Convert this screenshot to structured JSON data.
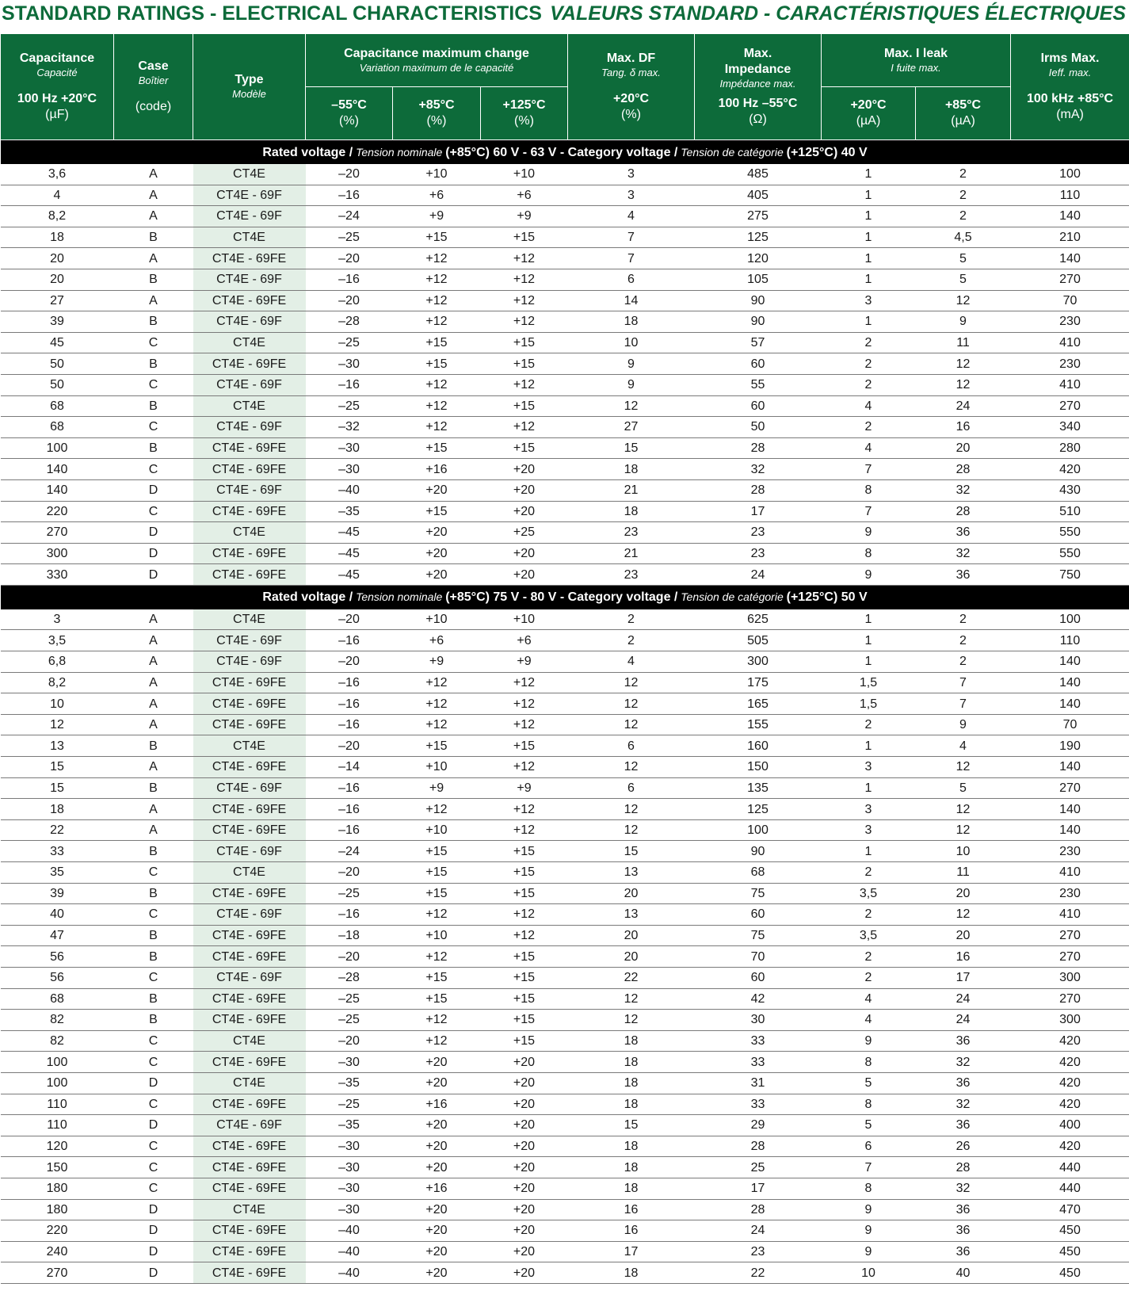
{
  "title_left": "STANDARD RATINGS - ELECTRICAL CHARACTERISTICS",
  "title_right": "VALEURS STANDARD - CARACTÉRISTIQUES ÉLECTRIQUES",
  "headers": {
    "capacitance": {
      "en": "Capacitance",
      "fr": "Capacité",
      "cond": "100 Hz +20°C",
      "unit": "(µF)"
    },
    "case": {
      "en": "Case",
      "fr": "Boîtier",
      "unit": "(code)"
    },
    "type": {
      "en": "Type",
      "fr": "Modèle"
    },
    "cap_change": {
      "en": "Capacitance maximum change",
      "fr": "Variation maximum de le capacité"
    },
    "cap_change_sub": [
      {
        "temp": "–55°C",
        "unit": "(%)"
      },
      {
        "temp": "+85°C",
        "unit": "(%)"
      },
      {
        "temp": "+125°C",
        "unit": "(%)"
      }
    ],
    "df": {
      "en": "Max. DF",
      "fr": "Tang. δ max.",
      "cond": "+20°C",
      "unit": "(%)"
    },
    "impedance": {
      "en1": "Max.",
      "en2": "Impedance",
      "fr": "Impédance max.",
      "cond": "100 Hz –55°C",
      "unit": "(Ω)"
    },
    "leak": {
      "en": "Max. I leak",
      "fr": "I fuite max."
    },
    "leak_sub": [
      {
        "temp": "+20°C",
        "unit": "(µA)"
      },
      {
        "temp": "+85°C",
        "unit": "(µA)"
      }
    ],
    "irms": {
      "en": "Irms Max.",
      "fr": "Ieff. max.",
      "cond": "100 kHz +85°C",
      "unit": "(mA)"
    }
  },
  "sections": [
    {
      "label": {
        "a": "Rated voltage /",
        "b": " Tension nominale ",
        "c": "(+85°C) 60 V - 63 V - Category voltage /",
        "d": " Tension de catégorie ",
        "e": "(+125°C) 40 V"
      },
      "rows": [
        [
          "3,6",
          "A",
          "CT4E",
          "–20",
          "+10",
          "+10",
          "3",
          "485",
          "1",
          "2",
          "100"
        ],
        [
          "4",
          "A",
          "CT4E - 69F",
          "–16",
          "+6",
          "+6",
          "3",
          "405",
          "1",
          "2",
          "110"
        ],
        [
          "8,2",
          "A",
          "CT4E - 69F",
          "–24",
          "+9",
          "+9",
          "4",
          "275",
          "1",
          "2",
          "140"
        ],
        [
          "18",
          "B",
          "CT4E",
          "–25",
          "+15",
          "+15",
          "7",
          "125",
          "1",
          "4,5",
          "210"
        ],
        [
          "20",
          "A",
          "CT4E - 69FE",
          "–20",
          "+12",
          "+12",
          "7",
          "120",
          "1",
          "5",
          "140"
        ],
        [
          "20",
          "B",
          "CT4E - 69F",
          "–16",
          "+12",
          "+12",
          "6",
          "105",
          "1",
          "5",
          "270"
        ],
        [
          "27",
          "A",
          "CT4E - 69FE",
          "–20",
          "+12",
          "+12",
          "14",
          "90",
          "3",
          "12",
          "70"
        ],
        [
          "39",
          "B",
          "CT4E - 69F",
          "–28",
          "+12",
          "+12",
          "18",
          "90",
          "1",
          "9",
          "230"
        ],
        [
          "45",
          "C",
          "CT4E",
          "–25",
          "+15",
          "+15",
          "10",
          "57",
          "2",
          "11",
          "410"
        ],
        [
          "50",
          "B",
          "CT4E - 69FE",
          "–30",
          "+15",
          "+15",
          "9",
          "60",
          "2",
          "12",
          "230"
        ],
        [
          "50",
          "C",
          "CT4E - 69F",
          "–16",
          "+12",
          "+12",
          "9",
          "55",
          "2",
          "12",
          "410"
        ],
        [
          "68",
          "B",
          "CT4E",
          "–25",
          "+12",
          "+15",
          "12",
          "60",
          "4",
          "24",
          "270"
        ],
        [
          "68",
          "C",
          "CT4E - 69F",
          "–32",
          "+12",
          "+12",
          "27",
          "50",
          "2",
          "16",
          "340"
        ],
        [
          "100",
          "B",
          "CT4E - 69FE",
          "–30",
          "+15",
          "+15",
          "15",
          "28",
          "4",
          "20",
          "280"
        ],
        [
          "140",
          "C",
          "CT4E - 69FE",
          "–30",
          "+16",
          "+20",
          "18",
          "32",
          "7",
          "28",
          "420"
        ],
        [
          "140",
          "D",
          "CT4E - 69F",
          "–40",
          "+20",
          "+20",
          "21",
          "28",
          "8",
          "32",
          "430"
        ],
        [
          "220",
          "C",
          "CT4E - 69FE",
          "–35",
          "+15",
          "+20",
          "18",
          "17",
          "7",
          "28",
          "510"
        ],
        [
          "270",
          "D",
          "CT4E",
          "–45",
          "+20",
          "+25",
          "23",
          "23",
          "9",
          "36",
          "550"
        ],
        [
          "300",
          "D",
          "CT4E - 69FE",
          "–45",
          "+20",
          "+20",
          "21",
          "23",
          "8",
          "32",
          "550"
        ],
        [
          "330",
          "D",
          "CT4E - 69FE",
          "–45",
          "+20",
          "+20",
          "23",
          "24",
          "9",
          "36",
          "750"
        ]
      ]
    },
    {
      "label": {
        "a": "Rated voltage /",
        "b": " Tension nominale ",
        "c": "(+85°C) 75 V - 80 V - Category voltage /",
        "d": " Tension de catégorie ",
        "e": "(+125°C) 50 V"
      },
      "rows": [
        [
          "3",
          "A",
          "CT4E",
          "–20",
          "+10",
          "+10",
          "2",
          "625",
          "1",
          "2",
          "100"
        ],
        [
          "3,5",
          "A",
          "CT4E - 69F",
          "–16",
          "+6",
          "+6",
          "2",
          "505",
          "1",
          "2",
          "110"
        ],
        [
          "6,8",
          "A",
          "CT4E - 69F",
          "–20",
          "+9",
          "+9",
          "4",
          "300",
          "1",
          "2",
          "140"
        ],
        [
          "8,2",
          "A",
          "CT4E - 69FE",
          "–16",
          "+12",
          "+12",
          "12",
          "175",
          "1,5",
          "7",
          "140"
        ],
        [
          "10",
          "A",
          "CT4E - 69FE",
          "–16",
          "+12",
          "+12",
          "12",
          "165",
          "1,5",
          "7",
          "140"
        ],
        [
          "12",
          "A",
          "CT4E - 69FE",
          "–16",
          "+12",
          "+12",
          "12",
          "155",
          "2",
          "9",
          "70"
        ],
        [
          "13",
          "B",
          "CT4E",
          "–20",
          "+15",
          "+15",
          "6",
          "160",
          "1",
          "4",
          "190"
        ],
        [
          "15",
          "A",
          "CT4E - 69FE",
          "–14",
          "+10",
          "+12",
          "12",
          "150",
          "3",
          "12",
          "140"
        ],
        [
          "15",
          "B",
          "CT4E - 69F",
          "–16",
          "+9",
          "+9",
          "6",
          "135",
          "1",
          "5",
          "270"
        ],
        [
          "18",
          "A",
          "CT4E - 69FE",
          "–16",
          "+12",
          "+12",
          "12",
          "125",
          "3",
          "12",
          "140"
        ],
        [
          "22",
          "A",
          "CT4E - 69FE",
          "–16",
          "+10",
          "+12",
          "12",
          "100",
          "3",
          "12",
          "140"
        ],
        [
          "33",
          "B",
          "CT4E - 69F",
          "–24",
          "+15",
          "+15",
          "15",
          "90",
          "1",
          "10",
          "230"
        ],
        [
          "35",
          "C",
          "CT4E",
          "–20",
          "+15",
          "+15",
          "13",
          "68",
          "2",
          "11",
          "410"
        ],
        [
          "39",
          "B",
          "CT4E - 69FE",
          "–25",
          "+15",
          "+15",
          "20",
          "75",
          "3,5",
          "20",
          "230"
        ],
        [
          "40",
          "C",
          "CT4E - 69F",
          "–16",
          "+12",
          "+12",
          "13",
          "60",
          "2",
          "12",
          "410"
        ],
        [
          "47",
          "B",
          "CT4E - 69FE",
          "–18",
          "+10",
          "+12",
          "20",
          "75",
          "3,5",
          "20",
          "270"
        ],
        [
          "56",
          "B",
          "CT4E - 69FE",
          "–20",
          "+12",
          "+15",
          "20",
          "70",
          "2",
          "16",
          "270"
        ],
        [
          "56",
          "C",
          "CT4E - 69F",
          "–28",
          "+15",
          "+15",
          "22",
          "60",
          "2",
          "17",
          "300"
        ],
        [
          "68",
          "B",
          "CT4E - 69FE",
          "–25",
          "+15",
          "+15",
          "12",
          "42",
          "4",
          "24",
          "270"
        ],
        [
          "82",
          "B",
          "CT4E - 69FE",
          "–25",
          "+12",
          "+15",
          "12",
          "30",
          "4",
          "24",
          "300"
        ],
        [
          "82",
          "C",
          "CT4E",
          "–20",
          "+12",
          "+15",
          "18",
          "33",
          "9",
          "36",
          "420"
        ],
        [
          "100",
          "C",
          "CT4E - 69FE",
          "–30",
          "+20",
          "+20",
          "18",
          "33",
          "8",
          "32",
          "420"
        ],
        [
          "100",
          "D",
          "CT4E",
          "–35",
          "+20",
          "+20",
          "18",
          "31",
          "5",
          "36",
          "420"
        ],
        [
          "110",
          "C",
          "CT4E - 69FE",
          "–25",
          "+16",
          "+20",
          "18",
          "33",
          "8",
          "32",
          "420"
        ],
        [
          "110",
          "D",
          "CT4E - 69F",
          "–35",
          "+20",
          "+20",
          "15",
          "29",
          "5",
          "36",
          "400"
        ],
        [
          "120",
          "C",
          "CT4E - 69FE",
          "–30",
          "+20",
          "+20",
          "18",
          "28",
          "6",
          "26",
          "420"
        ],
        [
          "150",
          "C",
          "CT4E - 69FE",
          "–30",
          "+20",
          "+20",
          "18",
          "25",
          "7",
          "28",
          "440"
        ],
        [
          "180",
          "C",
          "CT4E - 69FE",
          "–30",
          "+16",
          "+20",
          "18",
          "17",
          "8",
          "32",
          "440"
        ],
        [
          "180",
          "D",
          "CT4E",
          "–30",
          "+20",
          "+20",
          "16",
          "28",
          "9",
          "36",
          "470"
        ],
        [
          "220",
          "D",
          "CT4E - 69FE",
          "–40",
          "+20",
          "+20",
          "16",
          "24",
          "9",
          "36",
          "450"
        ],
        [
          "240",
          "D",
          "CT4E - 69FE",
          "–40",
          "+20",
          "+20",
          "17",
          "23",
          "9",
          "36",
          "450"
        ],
        [
          "270",
          "D",
          "CT4E - 69FE",
          "–40",
          "+20",
          "+20",
          "18",
          "22",
          "10",
          "40",
          "450"
        ]
      ]
    }
  ]
}
